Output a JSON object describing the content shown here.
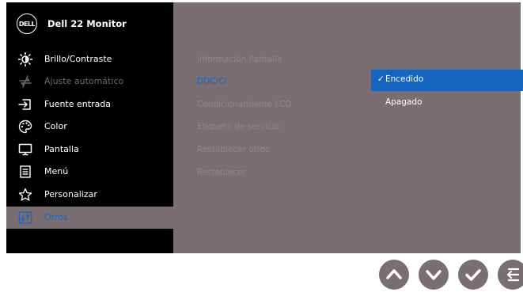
{
  "header": {
    "logo_text": "DELL",
    "model": "Dell 22 Monitor"
  },
  "menu": [
    {
      "label": "Brillo/Contraste",
      "icon": "brightness-icon"
    },
    {
      "label": "Ajuste automático",
      "icon": "auto-adjust-icon"
    },
    {
      "label": "Fuente entrada",
      "icon": "input-source-icon"
    },
    {
      "label": "Color",
      "icon": "palette-icon"
    },
    {
      "label": "Pantalla",
      "icon": "display-icon"
    },
    {
      "label": "Menú",
      "icon": "menu-icon"
    },
    {
      "label": "Personalizar",
      "icon": "star-icon"
    },
    {
      "label": "Otros",
      "icon": "others-icon"
    }
  ],
  "submenu": [
    "Información Pantalla",
    "DDC/CI",
    "Condicionamiento LCD",
    "Etiqueta de servicio",
    "Restablecer otros",
    "Restablecer"
  ],
  "options": [
    {
      "label": "Encedido",
      "checkmark": "✓"
    },
    {
      "label": "Apagado"
    }
  ],
  "buttons": [
    {
      "icon": "chevron-up-icon"
    },
    {
      "icon": "chevron-down-icon"
    },
    {
      "icon": "check-icon"
    },
    {
      "icon": "back-icon"
    }
  ],
  "colors": {
    "accent": "#1565c0",
    "panel": "#7a6e72",
    "sidebar": "#000000"
  }
}
